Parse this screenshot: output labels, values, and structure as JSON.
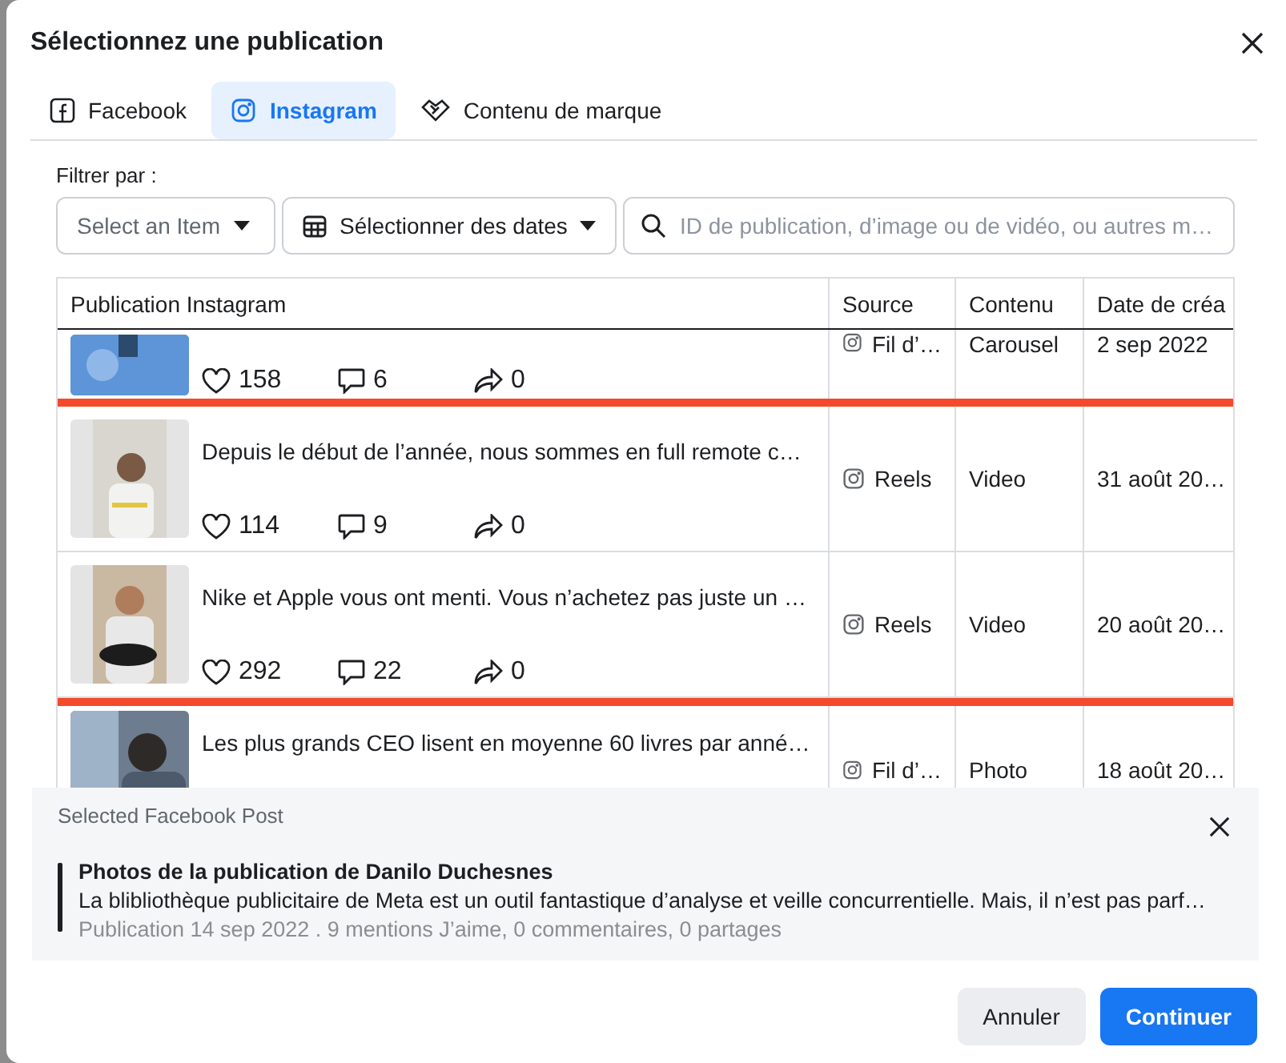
{
  "dialog": {
    "title": "Sélectionnez une publication"
  },
  "tabs": [
    {
      "label": "Facebook",
      "kind": "facebook",
      "selected": false
    },
    {
      "label": "Instagram",
      "kind": "instagram",
      "selected": true
    },
    {
      "label": "Contenu de marque",
      "kind": "branded",
      "selected": false
    }
  ],
  "filters": {
    "label": "Filtrer par :",
    "item_select": {
      "placeholder": "Select an Item"
    },
    "date_select": {
      "value": "Sélectionner des dates"
    },
    "search": {
      "placeholder": "ID de publication, d’image ou de vidéo, ou autres m…"
    }
  },
  "table": {
    "columns": [
      "Publication Instagram",
      "Source",
      "Contenu",
      "Date de créa"
    ],
    "rows": [
      {
        "likes": "158",
        "comments": "6",
        "shares": "0",
        "source": "Fil d’…",
        "content_type": "Carousel",
        "date": "2 sep 2022",
        "highlighted": false
      },
      {
        "caption": "Depuis le début de l’année, nous sommes en full remote c…",
        "likes": "114",
        "comments": "9",
        "shares": "0",
        "source": "Reels",
        "content_type": "Video",
        "date": "31 août 20…",
        "highlighted": true
      },
      {
        "caption": "Nike et Apple vous ont menti. Vous n’achetez pas juste un …",
        "likes": "292",
        "comments": "22",
        "shares": "0",
        "source": "Reels",
        "content_type": "Video",
        "date": "20 août 20…",
        "highlighted": true
      },
      {
        "caption": "Les plus grands CEO lisent en moyenne 60 livres par anné…",
        "source": "Fil d’…",
        "content_type": "Photo",
        "date": "18 août 20…",
        "highlighted": false
      }
    ]
  },
  "selected_post": {
    "heading": "Selected Facebook Post",
    "title": "Photos de la publication de Danilo Duchesnes",
    "text": "La blibliothèque publicitaire de Meta est un outil fantastique d’analyse et veille concurrentielle. Mais, il n’est pas parf…",
    "meta": "Publication 14 sep 2022 . 9 mentions J’aime, 0 commentaires, 0 partages"
  },
  "buttons": [
    {
      "label": "Annuler",
      "kind": "secondary"
    },
    {
      "label": "Continuer",
      "kind": "primary"
    }
  ]
}
